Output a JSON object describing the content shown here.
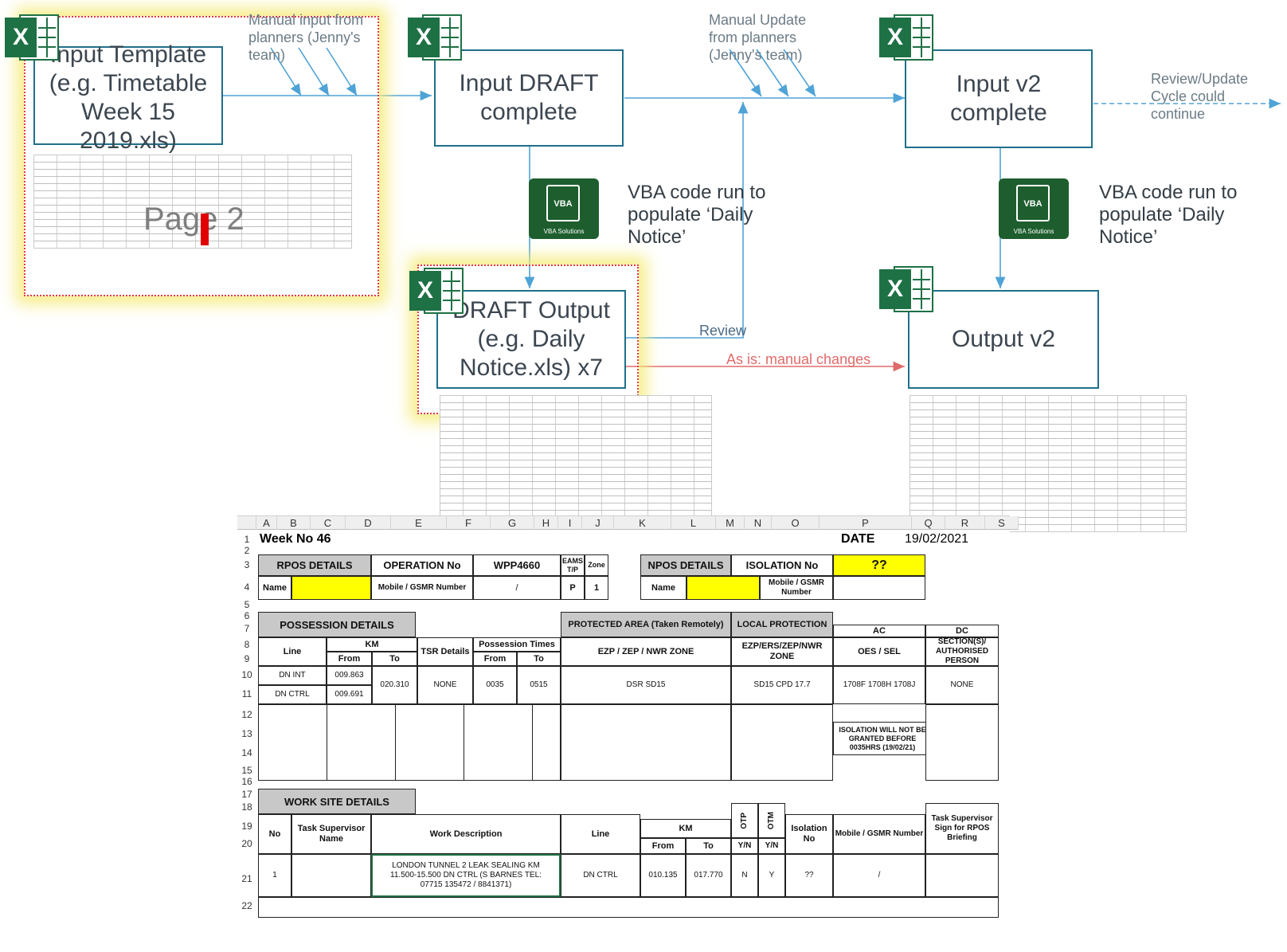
{
  "flow": {
    "input_template": "Input Template (e.g. Timetable Week 15 2019.xls)",
    "page_watermark": "Page 2",
    "manual_input_note": "Manual input from planners (Jenny's team)",
    "input_draft": "Input DRAFT complete",
    "manual_update_note": "Manual Update from planners (Jenny's team)",
    "input_v2": "Input v2 complete",
    "review_cycle_note": "Review/Update Cycle could continue",
    "vba_text_1": "VBA code run to populate ‘Daily Notice’",
    "vba_text_2": "VBA code run to populate ‘Daily Notice’",
    "vba_badge": "VBA",
    "vba_caption": "VBA Solutions",
    "excel_badge": "X",
    "draft_output": "DRAFT Output (e.g. Daily Notice.xls) x7",
    "review_label": "Review",
    "manual_changes_label": "As is: manual changes",
    "output_v2": "Output v2"
  },
  "colors": {
    "box_border": "#1f6f8b",
    "arrow": "#4fa3d6",
    "red_arrow": "#e06b6b",
    "excel_green": "#1e7145",
    "vba_green": "#1e5e2e",
    "highlight": "#f5eb78"
  },
  "sheet": {
    "columns": [
      "A",
      "B",
      "C",
      "D",
      "E",
      "F",
      "G",
      "H",
      "I",
      "J",
      "K",
      "L",
      "M",
      "N",
      "O",
      "P",
      "Q",
      "R",
      "S"
    ],
    "rows": [
      "1",
      "2",
      "3",
      "4",
      "5",
      "6",
      "7",
      "8",
      "9",
      "10",
      "11",
      "12",
      "13",
      "14",
      "15",
      "16",
      "17",
      "18",
      "19",
      "20",
      "21",
      "22"
    ],
    "week": "Week No 46",
    "date_label": "DATE",
    "date_value": "19/02/2021",
    "rpos_details": "RPOS DETAILS",
    "operation_no": "OPERATION No",
    "operation_value": "WPP4660",
    "eams_tp": "EAMS T/P",
    "zone": "Zone",
    "npos_details": "NPOS DETAILS",
    "isolation_no": "ISOLATION No",
    "isolation_value": "??",
    "name": "Name",
    "mobile_gsmr": "Mobile / GSMR Number",
    "slash": "/",
    "eams_value": "P",
    "zone_value": "1",
    "possession_details": "POSSESSION DETAILS",
    "protected_area": "PROTECTED AREA (Taken Remotely)",
    "local_protection": "LOCAL PROTECTION",
    "ac": "AC",
    "dc": "DC",
    "line": "Line",
    "km": "KM",
    "tsr_details": "TSR Details",
    "possession_times": "Possession Times",
    "from": "From",
    "to": "To",
    "ezp_zone": "EZP / ZEP / NWR ZONE",
    "ezp_ers_zone": "EZP/ERS/ZEP/NWR ZONE",
    "oes_sel": "OES / SEL",
    "sections": "SECTION(S)/ AUTHORISED PERSON",
    "line1": "DN INT",
    "line2": "DN CTRL",
    "km_from1": "009.863",
    "km_from2": "009.691",
    "km_to": "020.310",
    "tsr": "NONE",
    "pos_from": "0035",
    "pos_to": "0515",
    "ezp_value": "DSR SD15",
    "local_value": "SD15 CPD 17.7",
    "ac_value": "1708F 1708H 1708J",
    "dc_value": "NONE",
    "isolation_note": "ISOLATION WILL NOT BE GRANTED BEFORE 0035HRS (19/02/21)",
    "work_site_details": "WORK SITE DETAILS",
    "no": "No",
    "task_supervisor": "Task Supervisor Name",
    "work_description": "Work Description",
    "otp": "OTP",
    "otm": "OTM",
    "isolation": "Isolation No",
    "task_sign": "Task Supervisor Sign for RPOS Briefing",
    "yn": "Y/N",
    "ws_no": "1",
    "ws_desc": "LONDON TUNNEL 2 LEAK SEALING KM 11.500-15.500 DN CTRL (S BARNES TEL: 07715 135472 / 8841371)",
    "ws_line": "DN CTRL",
    "ws_from": "010.135",
    "ws_to": "017.770",
    "ws_otp": "N",
    "ws_otm": "Y",
    "ws_iso": "??",
    "ws_mobile": "/"
  }
}
